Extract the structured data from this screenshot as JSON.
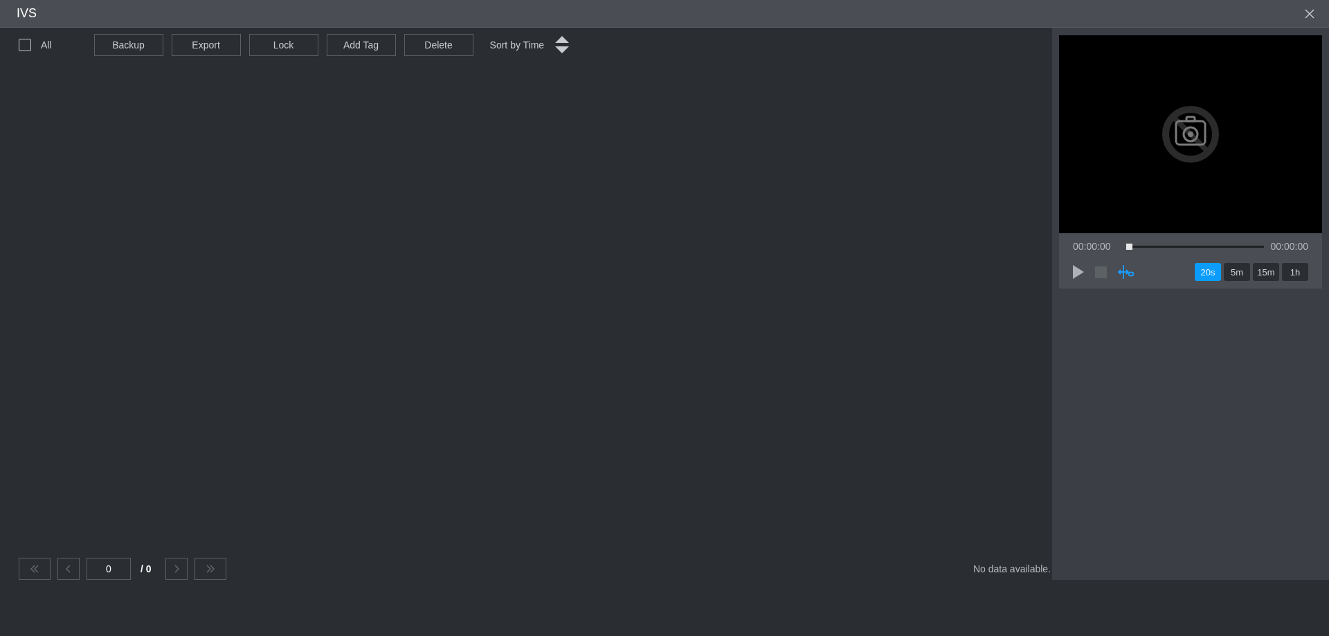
{
  "window": {
    "title": "IVS"
  },
  "toolbar": {
    "select_all": {
      "label": "All",
      "checked": false
    },
    "buttons": [
      "Backup",
      "Export",
      "Lock",
      "Add Tag",
      "Delete"
    ],
    "sort": {
      "label": "Sort by Time"
    }
  },
  "pagination": {
    "page": "0",
    "total": "/ 0"
  },
  "empty_message": "No data available.",
  "player": {
    "start_time": "00:00:00",
    "end_time": "00:00:00",
    "level": 0,
    "durations": [
      {
        "label": "20s",
        "selected": true
      },
      {
        "label": "5m",
        "selected": false
      },
      {
        "label": "15m",
        "selected": false
      },
      {
        "label": "1h",
        "selected": false
      }
    ]
  }
}
